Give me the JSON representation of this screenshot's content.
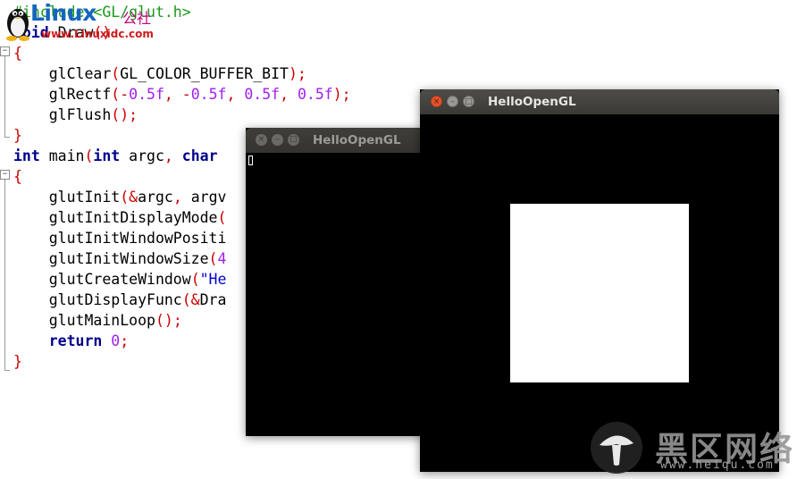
{
  "editor": {
    "lines": [
      [
        {
          "c": "pp",
          "t": "#include <GL/glut.h>"
        }
      ],
      [
        {
          "c": "kw",
          "t": "void"
        },
        {
          "c": "",
          "t": " Draw"
        },
        {
          "c": "op",
          "t": "()"
        }
      ],
      [
        {
          "c": "op",
          "t": "{"
        }
      ],
      [
        {
          "c": "",
          "t": "    glClear"
        },
        {
          "c": "op",
          "t": "("
        },
        {
          "c": "",
          "t": "GL_COLOR_BUFFER_BIT"
        },
        {
          "c": "op",
          "t": ");"
        }
      ],
      [
        {
          "c": "",
          "t": "    glRectf"
        },
        {
          "c": "op",
          "t": "(-"
        },
        {
          "c": "num",
          "t": "0.5f"
        },
        {
          "c": "op",
          "t": ", -"
        },
        {
          "c": "num",
          "t": "0.5f"
        },
        {
          "c": "op",
          "t": ", "
        },
        {
          "c": "num",
          "t": "0.5f"
        },
        {
          "c": "op",
          "t": ", "
        },
        {
          "c": "num",
          "t": "0.5f"
        },
        {
          "c": "op",
          "t": ");"
        }
      ],
      [
        {
          "c": "",
          "t": "    glFlush"
        },
        {
          "c": "op",
          "t": "();"
        }
      ],
      [
        {
          "c": "op",
          "t": "}"
        }
      ],
      [
        {
          "c": "kw",
          "t": "int"
        },
        {
          "c": "",
          "t": " main"
        },
        {
          "c": "op",
          "t": "("
        },
        {
          "c": "kw",
          "t": "int"
        },
        {
          "c": "",
          "t": " argc"
        },
        {
          "c": "op",
          "t": ", "
        },
        {
          "c": "kw",
          "t": "char"
        }
      ],
      [
        {
          "c": "op",
          "t": "{"
        }
      ],
      [
        {
          "c": "",
          "t": "    glutInit"
        },
        {
          "c": "op",
          "t": "(&"
        },
        {
          "c": "",
          "t": "argc"
        },
        {
          "c": "op",
          "t": ", "
        },
        {
          "c": "",
          "t": "argv"
        }
      ],
      [
        {
          "c": "",
          "t": "    glutInitDisplayMode"
        },
        {
          "c": "op",
          "t": "("
        }
      ],
      [
        {
          "c": "",
          "t": "    glutInitWindowPositi"
        }
      ],
      [
        {
          "c": "",
          "t": "    glutInitWindowSize"
        },
        {
          "c": "op",
          "t": "("
        },
        {
          "c": "num",
          "t": "4"
        }
      ],
      [
        {
          "c": "",
          "t": "    glutCreateWindow"
        },
        {
          "c": "op",
          "t": "("
        },
        {
          "c": "str",
          "t": "\"He"
        }
      ],
      [
        {
          "c": "",
          "t": "    glutDisplayFunc"
        },
        {
          "c": "op",
          "t": "(&"
        },
        {
          "c": "",
          "t": "Dra"
        }
      ],
      [
        {
          "c": "",
          "t": "    glutMainLoop"
        },
        {
          "c": "op",
          "t": "();"
        }
      ],
      [
        {
          "c": "kw",
          "t": "    return"
        },
        {
          "c": "",
          "t": " "
        },
        {
          "c": "num",
          "t": "0"
        },
        {
          "c": "op",
          "t": ";"
        }
      ],
      [
        {
          "c": "op",
          "t": "}"
        }
      ]
    ],
    "fold_marker": "−"
  },
  "watermark_top": {
    "brand": "Linux",
    "brand_cn": "公社",
    "url": "www.Linuxidc.com"
  },
  "watermark_bottom": {
    "brand_cn": "黑区网络",
    "url": "www.heiqu.com"
  },
  "windows": {
    "back": {
      "title": "HelloOpenGL",
      "focused": false
    },
    "front": {
      "title": "HelloOpenGL",
      "focused": true
    }
  },
  "window_buttons": {
    "close": "×",
    "minimize": "–",
    "maximize": "□"
  },
  "colors": {
    "keyword": "#00008b",
    "number": "#a020f0",
    "preprocessor": "#1a9a1a",
    "operator": "#cc0000",
    "string": "#0000d0",
    "titlebar": "#3c3b37",
    "close_button": "#e2532a"
  }
}
